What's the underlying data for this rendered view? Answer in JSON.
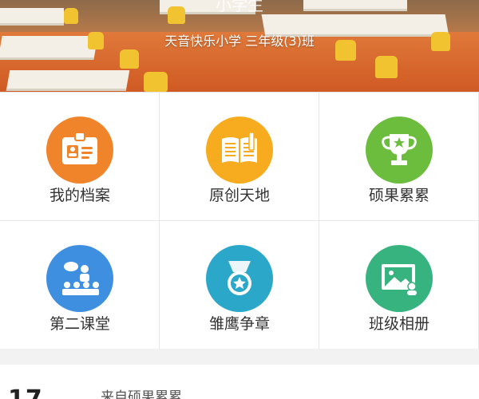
{
  "header": {
    "title": "小学生",
    "class_name": "天音快乐小学 三年级(3)班"
  },
  "menu": [
    {
      "label": "我的档案",
      "icon": "id-card-icon",
      "color": "#f0842b"
    },
    {
      "label": "原创天地",
      "icon": "book-icon",
      "color": "#f6ac1e"
    },
    {
      "label": "硕果累累",
      "icon": "trophy-icon",
      "color": "#6cbd3e"
    },
    {
      "label": "第二课堂",
      "icon": "classroom-icon",
      "color": "#3f8fe0"
    },
    {
      "label": "雏鹰争章",
      "icon": "medal-icon",
      "color": "#2aa7c9"
    },
    {
      "label": "班级相册",
      "icon": "photo-album-icon",
      "color": "#36b37e"
    }
  ],
  "feed": {
    "day": "17",
    "source": "来自硕果累累"
  }
}
